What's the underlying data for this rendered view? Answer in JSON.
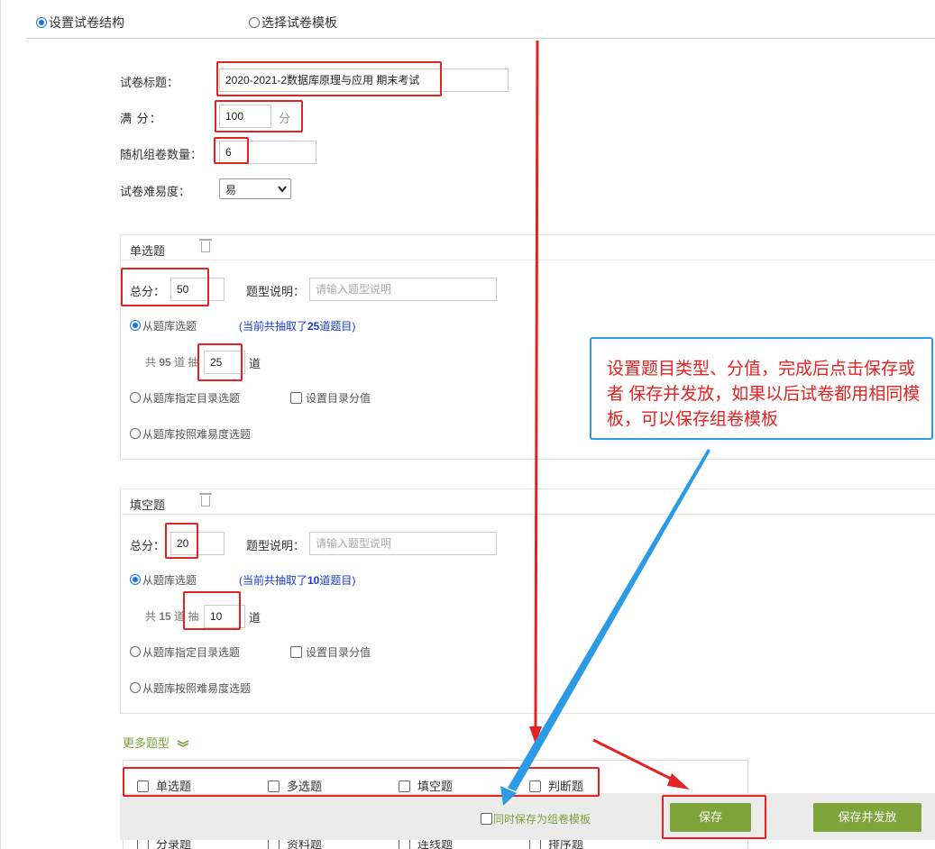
{
  "mode_tabs": [
    {
      "label": "设置试卷结构",
      "selected": true
    },
    {
      "label": "选择试卷模板",
      "selected": false
    }
  ],
  "form": {
    "title_label": "试卷标题：",
    "title_value": "2020-2021-2数据库原理与应用 期末考试",
    "full_score_label": "满 分：",
    "full_score_value": "100",
    "full_score_unit": "分",
    "random_count_label": "随机组卷数量：",
    "random_count_value": "6",
    "difficulty_label": "试卷难易度：",
    "difficulty_value": "易"
  },
  "sections": [
    {
      "name": "单选题",
      "total_label": "总分：",
      "total_value": "50",
      "desc_label": "题型说明：",
      "desc_placeholder": "请输入题型说明",
      "opt_bank": "从题库选题",
      "drawn_note_prefix": "(当前共抽取了",
      "drawn_count": "25",
      "drawn_note_suffix": "道题目)",
      "count_prefix": "共",
      "count_total": "95",
      "count_mid": "道 抽",
      "draw_value": "25",
      "count_suffix": "道",
      "opt_catalog": "从题库指定目录选题",
      "set_catalog_score": "设置目录分值",
      "opt_difficulty": "从题库按照难易度选题"
    },
    {
      "name": "填空题",
      "total_label": "总分：",
      "total_value": "20",
      "desc_label": "题型说明：",
      "desc_placeholder": "请输入题型说明",
      "opt_bank": "从题库选题",
      "drawn_note_prefix": "(当前共抽取了",
      "drawn_count": "10",
      "drawn_note_suffix": "道题目)",
      "count_prefix": "共",
      "count_total": "15",
      "count_mid": "道 抽",
      "draw_value": "10",
      "count_suffix": "道",
      "opt_catalog": "从题库指定目录选题",
      "set_catalog_score": "设置目录分值",
      "opt_difficulty": "从题库按照难易度选题"
    }
  ],
  "more_types": {
    "label": "更多题型",
    "row1": [
      "单选题",
      "多选题",
      "填空题",
      "判断题"
    ],
    "row2": [
      "分录题",
      "资料题",
      "连线题",
      "排序题"
    ]
  },
  "footer": {
    "save_template_label": "同时保存为组卷模板",
    "save_label": "保存",
    "save_publish_label": "保存并发放"
  },
  "callout": {
    "text": "设置题目类型、分值，完成后点击保存或者 保存并发放，如果以后试卷都用相同模板，可以保存组卷模板"
  },
  "colors": {
    "annotation_red": "#e52222",
    "annotation_blue": "#2b9be6",
    "button_green": "#7ea43a",
    "link_blue": "#1a3ccc"
  }
}
